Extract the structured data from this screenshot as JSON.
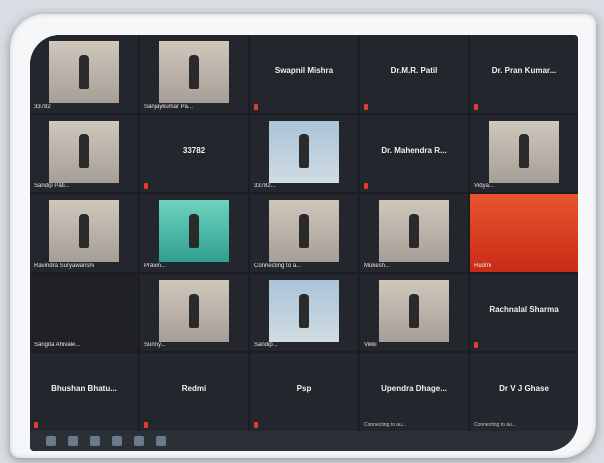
{
  "tiles": [
    {
      "label": "33782",
      "kind": "video"
    },
    {
      "label": "Sanjaykumar Pa...",
      "kind": "video-red"
    },
    {
      "name": "Swapnil Mishra"
    },
    {
      "name": "Dr.M.R. Patil"
    },
    {
      "name": "Dr. Pran Kumar..."
    },
    {
      "label": "Sandip Pati...",
      "kind": "video"
    },
    {
      "name": "33782"
    },
    {
      "label": "33782...",
      "kind": "video-sky"
    },
    {
      "name": "Dr. Mahendra R..."
    },
    {
      "label": "Vidya...",
      "kind": "video"
    },
    {
      "label": "Ravindra Suryawanshi",
      "kind": "video"
    },
    {
      "label": "Pravin...",
      "kind": "video-green"
    },
    {
      "label": "Connecting to a...",
      "kind": "video"
    },
    {
      "label": "Mukesh...",
      "kind": "video"
    },
    {
      "label": "Redmi",
      "kind": "video-red-full"
    },
    {
      "label": "Sangita Ahivale...",
      "kind": "dark"
    },
    {
      "label": "Sunny...",
      "kind": "video"
    },
    {
      "label": "Sandip...",
      "kind": "video-sky"
    },
    {
      "label": "Vikki",
      "kind": "video"
    },
    {
      "name": "Rachnalal Sharma"
    },
    {
      "name": "Bhushan Bhatu..."
    },
    {
      "name": "Redmi"
    },
    {
      "name": "Psp"
    },
    {
      "name": "Upendra Dhage...",
      "connecting": "Connecting to au..."
    },
    {
      "name": "Dr V J Ghase",
      "connecting": "Connecting to au..."
    }
  ],
  "taskbar": [
    "windows-icon",
    "ie-icon",
    "folder-icon",
    "media-icon",
    "zoom-icon",
    "app-icon"
  ]
}
